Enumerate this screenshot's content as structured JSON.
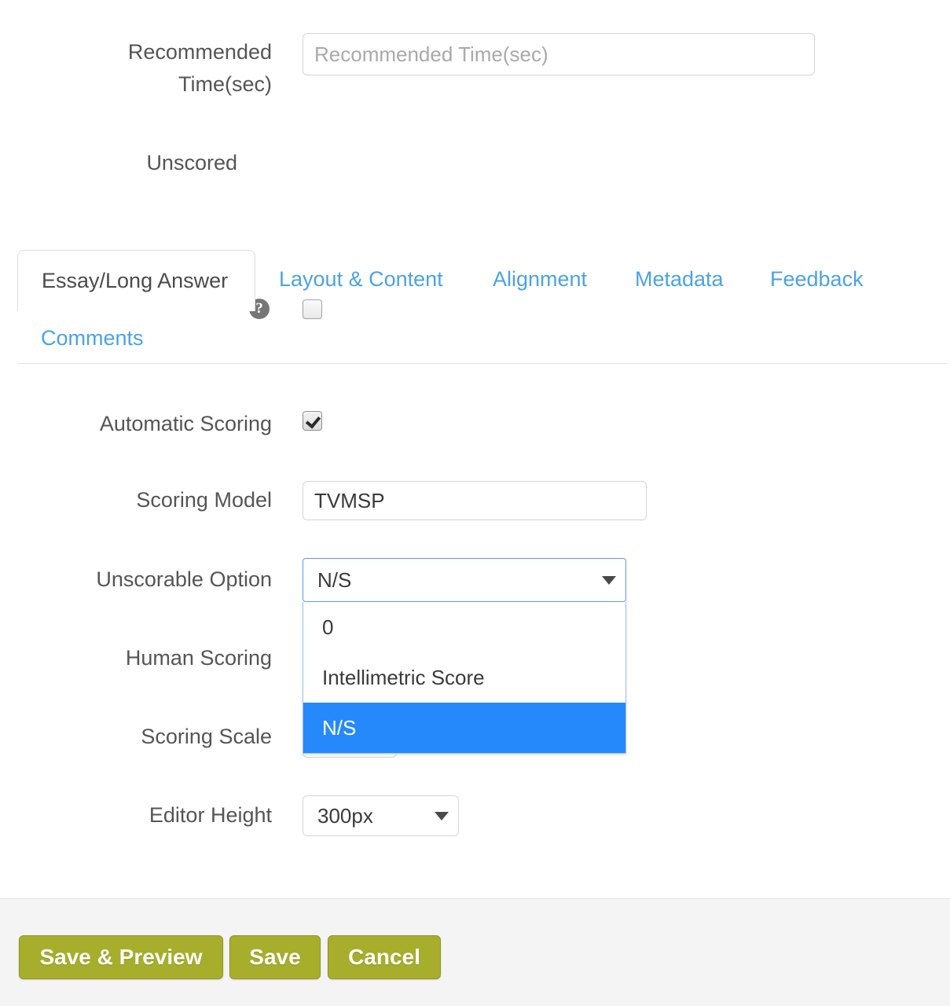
{
  "form": {
    "recommended_time": {
      "label": "Recommended\nTime(sec)",
      "placeholder": "Recommended Time(sec)",
      "value": ""
    },
    "unscored": {
      "label": "Unscored",
      "help_icon": "question-mark-icon",
      "checked": false
    }
  },
  "tabs": {
    "items": [
      {
        "label": "Essay/Long Answer",
        "active": true
      },
      {
        "label": "Layout & Content",
        "active": false
      },
      {
        "label": "Alignment",
        "active": false
      },
      {
        "label": "Metadata",
        "active": false
      },
      {
        "label": "Feedback",
        "active": false
      },
      {
        "label": "Comments",
        "active": false
      }
    ]
  },
  "panel": {
    "automatic_scoring": {
      "label": "Automatic Scoring",
      "checked": true
    },
    "scoring_model": {
      "label": "Scoring Model",
      "value": "TVMSP"
    },
    "unscorable_option": {
      "label": "Unscorable Option",
      "value": "N/S",
      "expanded": true,
      "options": [
        "0",
        "Intellimetric Score",
        "N/S"
      ],
      "selected_index": 2
    },
    "human_scoring": {
      "label": "Human Scoring"
    },
    "scoring_scale": {
      "label": "Scoring Scale"
    },
    "editor_height": {
      "label": "Editor Height",
      "value": "300px",
      "options": [
        "300px"
      ]
    }
  },
  "footer": {
    "save_preview_label": "Save & Preview",
    "save_label": "Save",
    "cancel_label": "Cancel"
  },
  "colors": {
    "accent_blue": "#2589fc",
    "link_blue": "#4ba3e3",
    "button_olive": "#a7ae2b",
    "label_gray": "#555555",
    "footer_bg": "#f4f4f4"
  }
}
